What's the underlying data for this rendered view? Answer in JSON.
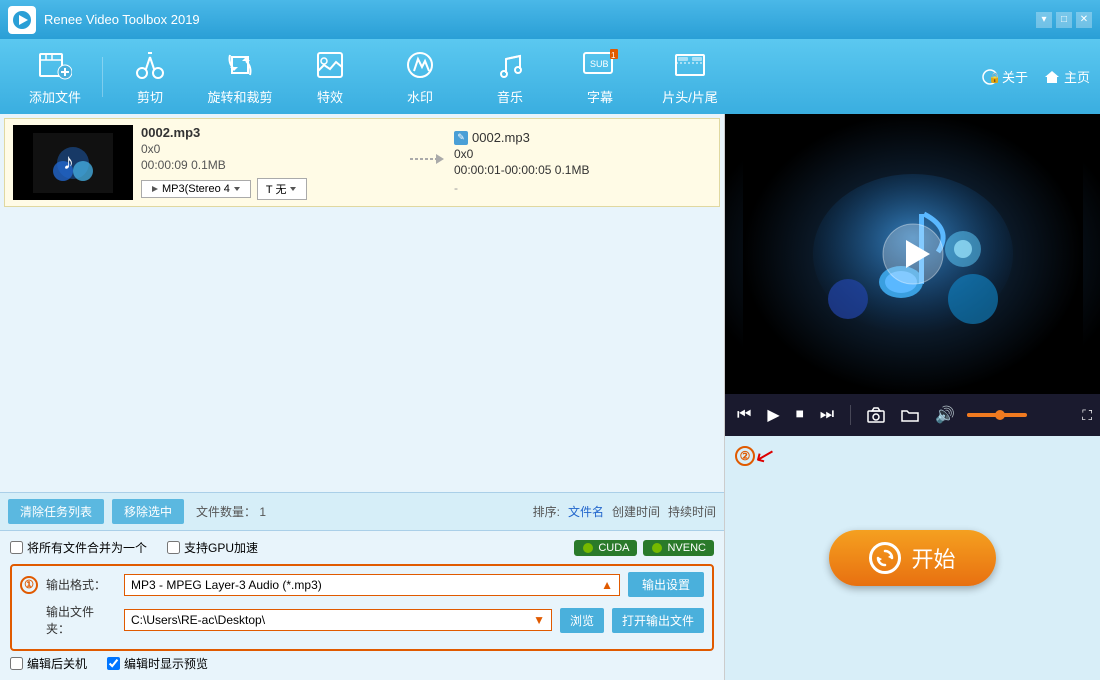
{
  "titlebar": {
    "title": "Renee Video Toolbox 2019",
    "logo": "R"
  },
  "toolbar": {
    "buttons": [
      {
        "id": "add-file",
        "label": "添加文件",
        "icon": "film-add"
      },
      {
        "id": "cut",
        "label": "剪切",
        "icon": "scissors"
      },
      {
        "id": "rotate-crop",
        "label": "旋转和裁剪",
        "icon": "rotate"
      },
      {
        "id": "effects",
        "label": "特效",
        "icon": "sparkle"
      },
      {
        "id": "watermark",
        "label": "水印",
        "icon": "watermark"
      },
      {
        "id": "music",
        "label": "音乐",
        "icon": "music"
      },
      {
        "id": "subtitle",
        "label": "字幕",
        "icon": "subtitle"
      },
      {
        "id": "intro-outro",
        "label": "片头/片尾",
        "icon": "intro"
      }
    ],
    "about": "关于",
    "home": "主页"
  },
  "file": {
    "name": "0002.mp3",
    "dims": "0x0",
    "duration": "00:00:09",
    "size": "0.1MB",
    "audio_format": "MP3(Stereo 4",
    "text_label": "T 无",
    "output_name": "0002.mp3",
    "output_dims": "0x0",
    "output_duration": "00:00:01-00:00:05",
    "output_size": "0.1MB",
    "output_dots": "..."
  },
  "statusbar": {
    "clear_btn": "清除任务列表",
    "remove_btn": "移除选中",
    "file_count_label": "文件数量：",
    "file_count": "1",
    "sort_label": "排序:",
    "sort_filename": "文件名",
    "sort_created": "创建时间",
    "sort_duration": "持续时间"
  },
  "output": {
    "merge_label": "将所有文件合并为一个",
    "gpu_label": "支持GPU加速",
    "cuda_label": "CUDA",
    "nvenc_label": "NVENC",
    "format_label": "输出格式：",
    "format_value": "MP3 - MPEG Layer-3 Audio (*.mp3)",
    "settings_btn": "输出设置",
    "folder_label": "输出文件夹：",
    "folder_value": "C:\\Users\\RE-ac\\Desktop\\",
    "browse_btn": "浏览",
    "open_btn": "打开输出文件",
    "shutdown_label": "编辑后关机",
    "preview_label": "编辑时显示预览",
    "circle1": "①",
    "circle2": "②"
  },
  "player": {
    "start_btn": "开始"
  }
}
